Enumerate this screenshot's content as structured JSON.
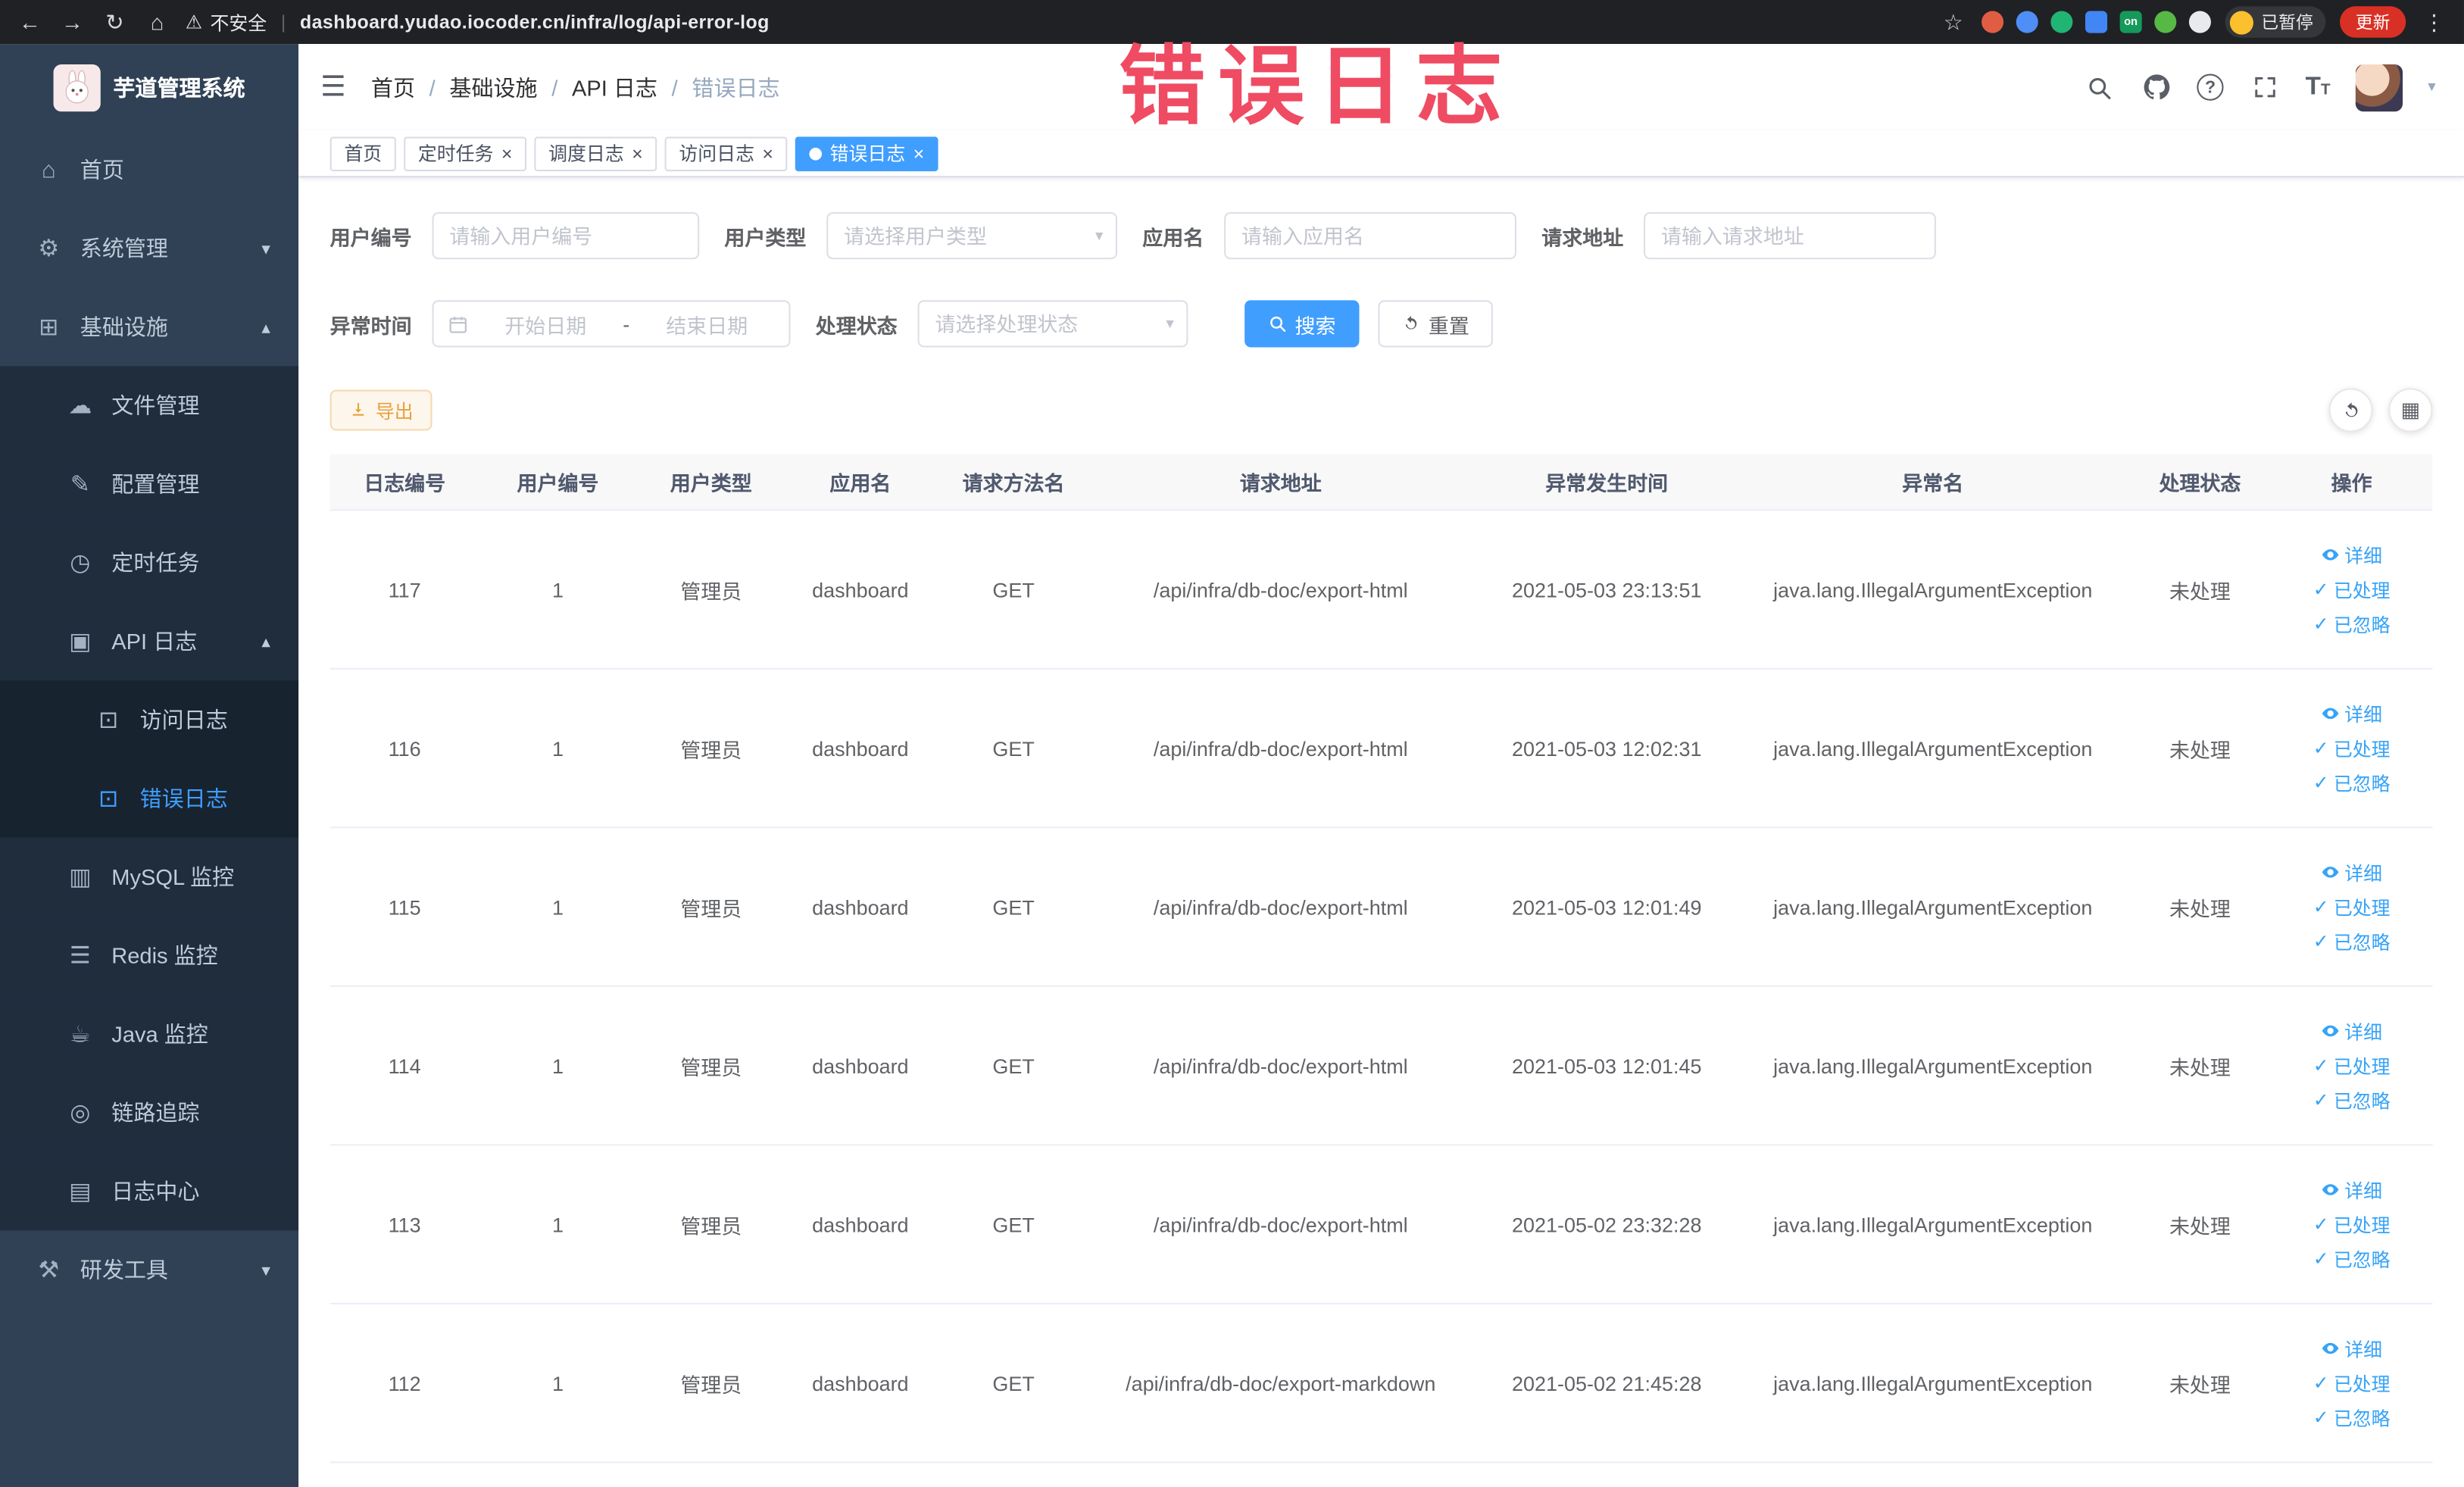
{
  "colors": {
    "accent": "#409eff",
    "warning": "#e6a23c",
    "annotation": "#ef4b63",
    "sidebar_bg": "#304156",
    "submenu_bg": "#1f2d3d",
    "chrome_bg": "#202124",
    "active_tab_bg": "#409eff",
    "link": "#36a3f7"
  },
  "browser": {
    "security_label": "不安全",
    "url": "dashboard.yudao.iocoder.cn/infra/log/api-error-log",
    "paused_badge_label": "已暂停",
    "update_label": "更新",
    "extensions": [
      {
        "name": "extension-icon-red",
        "color": "#e05d44",
        "shape": "circle",
        "glyph": ""
      },
      {
        "name": "extension-icon-blue",
        "color": "#4f8ef7",
        "shape": "circle",
        "glyph": ""
      },
      {
        "name": "extension-icon-green",
        "color": "#21b573",
        "shape": "circle",
        "glyph": ""
      },
      {
        "name": "extension-icon-grid",
        "color": "#4285f4",
        "shape": "square",
        "glyph": ""
      },
      {
        "name": "extension-icon-on",
        "color": "#159a5b",
        "shape": "square",
        "glyph": "on"
      },
      {
        "name": "extension-icon-leaf",
        "color": "#57b846",
        "shape": "circle",
        "glyph": ""
      },
      {
        "name": "extension-icon-paw",
        "color": "#e8eaed",
        "shape": "circle",
        "glyph": ""
      }
    ]
  },
  "annotation_text": "错误日志",
  "sidebar": {
    "logo_title": "芋道管理系统",
    "menu": [
      {
        "key": "home",
        "label": "首页",
        "icon": "home-icon",
        "level": 1
      },
      {
        "key": "system",
        "label": "系统管理",
        "icon": "system-icon",
        "level": 1,
        "arrow": "down"
      },
      {
        "key": "infra",
        "label": "基础设施",
        "icon": "infra-icon",
        "level": 1,
        "arrow": "up"
      },
      {
        "key": "file",
        "label": "文件管理",
        "icon": "file-icon",
        "level": 2
      },
      {
        "key": "config",
        "label": "配置管理",
        "icon": "config-icon",
        "level": 2
      },
      {
        "key": "job",
        "label": "定时任务",
        "icon": "job-icon",
        "level": 2
      },
      {
        "key": "api-log",
        "label": "API 日志",
        "icon": "api-log-icon",
        "level": 2,
        "arrow": "up"
      },
      {
        "key": "access-log",
        "label": "访问日志",
        "icon": "access-log-icon",
        "level": 3
      },
      {
        "key": "error-log",
        "label": "错误日志",
        "icon": "error-log-icon",
        "level": 3,
        "active": true
      },
      {
        "key": "mysql",
        "label": "MySQL 监控",
        "icon": "mysql-icon",
        "level": 2
      },
      {
        "key": "redis",
        "label": "Redis 监控",
        "icon": "redis-icon",
        "level": 2
      },
      {
        "key": "java",
        "label": "Java 监控",
        "icon": "java-icon",
        "level": 2
      },
      {
        "key": "trace",
        "label": "链路追踪",
        "icon": "trace-icon",
        "level": 2
      },
      {
        "key": "log-center",
        "label": "日志中心",
        "icon": "log-center-icon",
        "level": 2
      },
      {
        "key": "dev-tools",
        "label": "研发工具",
        "icon": "dev-tools-icon",
        "level": 1,
        "arrow": "down"
      }
    ]
  },
  "icons": {
    "home-icon": "⌂",
    "system-icon": "⚙",
    "infra-icon": "⊞",
    "file-icon": "☁",
    "config-icon": "✎",
    "job-icon": "◷",
    "api-log-icon": "▣",
    "access-log-icon": "⊡",
    "error-log-icon": "⊡",
    "mysql-icon": "▥",
    "redis-icon": "☰",
    "java-icon": "☕",
    "trace-icon": "◎",
    "log-center-icon": "▤",
    "dev-tools-icon": "⚒",
    "hamburger-icon": "☰",
    "caret-down-icon": "▾",
    "star-icon": "☆",
    "warning-icon": "⚠",
    "back-icon": "←",
    "forward-icon": "→",
    "reload-icon": "↻",
    "chrome-home-icon": "⌂",
    "menu-dots-icon": "⋮",
    "grid-icon": "▦",
    "select-caret-icon": "▾"
  },
  "header": {
    "breadcrumb": [
      "首页",
      "基础设施",
      "API 日志",
      "错误日志"
    ],
    "font_size_icon_text": "T"
  },
  "tabs": [
    {
      "key": "home",
      "label": "首页",
      "closable": false,
      "active": false
    },
    {
      "key": "job",
      "label": "定时任务",
      "closable": true,
      "active": false
    },
    {
      "key": "job-log",
      "label": "调度日志",
      "closable": true,
      "active": false
    },
    {
      "key": "access-log",
      "label": "访问日志",
      "closable": true,
      "active": false
    },
    {
      "key": "error-log",
      "label": "错误日志",
      "closable": true,
      "active": true
    }
  ],
  "filters": {
    "user_id_label": "用户编号",
    "user_id_placeholder": "请输入用户编号",
    "user_type_label": "用户类型",
    "user_type_placeholder": "请选择用户类型",
    "app_name_label": "应用名",
    "app_name_placeholder": "请输入应用名",
    "request_url_label": "请求地址",
    "request_url_placeholder": "请输入请求地址",
    "exception_time_label": "异常时间",
    "date_start_placeholder": "开始日期",
    "date_separator": "-",
    "date_end_placeholder": "结束日期",
    "process_status_label": "处理状态",
    "process_status_placeholder": "请选择处理状态",
    "search_label": "搜索",
    "reset_label": "重置"
  },
  "toolbar": {
    "export_label": "导出"
  },
  "table": {
    "columns": [
      "日志编号",
      "用户编号",
      "用户类型",
      "应用名",
      "请求方法名",
      "请求地址",
      "异常发生时间",
      "异常名",
      "处理状态",
      "操作"
    ],
    "actions": [
      "详细",
      "已处理",
      "已忽略"
    ],
    "rows": [
      {
        "id": "117",
        "user_id": "1",
        "user_type": "管理员",
        "app": "dashboard",
        "method": "GET",
        "url": "/api/infra/db-doc/export-html",
        "time": "2021-05-03 23:13:51",
        "exception": "java.lang.IllegalArgumentException",
        "status": "未处理"
      },
      {
        "id": "116",
        "user_id": "1",
        "user_type": "管理员",
        "app": "dashboard",
        "method": "GET",
        "url": "/api/infra/db-doc/export-html",
        "time": "2021-05-03 12:02:31",
        "exception": "java.lang.IllegalArgumentException",
        "status": "未处理"
      },
      {
        "id": "115",
        "user_id": "1",
        "user_type": "管理员",
        "app": "dashboard",
        "method": "GET",
        "url": "/api/infra/db-doc/export-html",
        "time": "2021-05-03 12:01:49",
        "exception": "java.lang.IllegalArgumentException",
        "status": "未处理"
      },
      {
        "id": "114",
        "user_id": "1",
        "user_type": "管理员",
        "app": "dashboard",
        "method": "GET",
        "url": "/api/infra/db-doc/export-html",
        "time": "2021-05-03 12:01:45",
        "exception": "java.lang.IllegalArgumentException",
        "status": "未处理"
      },
      {
        "id": "113",
        "user_id": "1",
        "user_type": "管理员",
        "app": "dashboard",
        "method": "GET",
        "url": "/api/infra/db-doc/export-html",
        "time": "2021-05-02 23:32:28",
        "exception": "java.lang.IllegalArgumentException",
        "status": "未处理"
      },
      {
        "id": "112",
        "user_id": "1",
        "user_type": "管理员",
        "app": "dashboard",
        "method": "GET",
        "url": "/api/infra/db-doc/export-markdown",
        "time": "2021-05-02 21:45:28",
        "exception": "java.lang.IllegalArgumentException",
        "status": "未处理"
      }
    ]
  }
}
